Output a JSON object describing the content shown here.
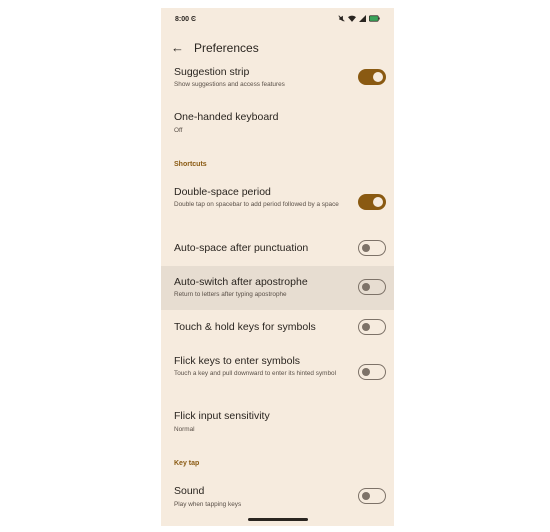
{
  "status": {
    "time": "8:00",
    "time_suffix": "Ͼ"
  },
  "appbar": {
    "title": "Preferences"
  },
  "settings": {
    "suggestion_strip": {
      "label": "Suggestion strip",
      "sub": "Show suggestions and access features",
      "enabled": true
    },
    "one_handed": {
      "label": "One-handed keyboard",
      "sub": "Off"
    },
    "shortcuts_header": "Shortcuts",
    "double_space": {
      "label": "Double-space period",
      "sub": "Double tap on spacebar to add period followed by a space",
      "enabled": true
    },
    "auto_space": {
      "label": "Auto-space after punctuation",
      "enabled": false
    },
    "auto_switch": {
      "label": "Auto-switch after apostrophe",
      "sub": "Return to letters after typing apostrophe",
      "enabled": false
    },
    "touch_hold": {
      "label": "Touch & hold keys for symbols",
      "enabled": false
    },
    "flick_keys": {
      "label": "Flick keys to enter symbols",
      "sub": "Touch a key and pull downward to enter its hinted symbol",
      "enabled": false
    },
    "flick_sensitivity": {
      "label": "Flick input sensitivity",
      "sub": "Normal"
    },
    "keytap_header": "Key tap",
    "sound": {
      "label": "Sound",
      "sub": "Play when tapping keys",
      "enabled": false
    }
  },
  "colors": {
    "accent": "#8a5a12",
    "background": "#f6ebde",
    "highlight": "#e7ddd1"
  }
}
